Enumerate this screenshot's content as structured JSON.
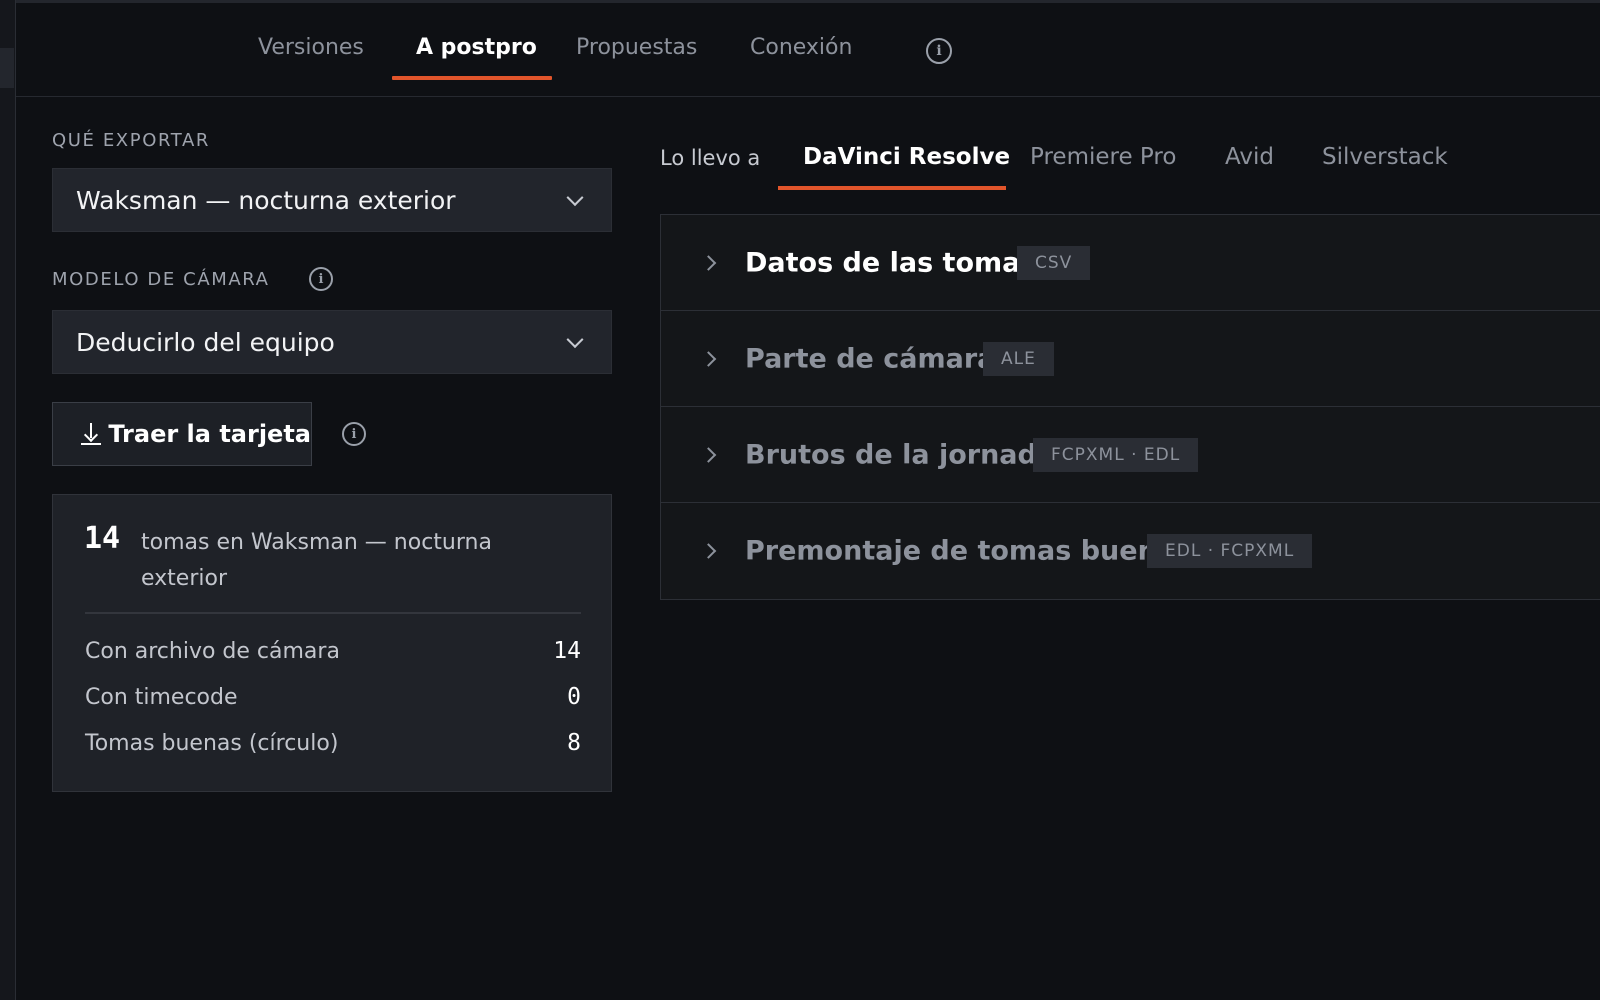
{
  "top_tabs": [
    {
      "label": "Versiones"
    },
    {
      "label": "A postpro",
      "active": true
    },
    {
      "label": "Propuestas"
    },
    {
      "label": "Conexión"
    }
  ],
  "export": {
    "section_label": "QUÉ EXPORTAR",
    "selected": "Waksman — nocturna exterior"
  },
  "camera": {
    "section_label": "MODELO DE CÁMARA",
    "selected": "Deducirlo del equipo"
  },
  "import_button": {
    "label": "Traer la tarjeta"
  },
  "summary": {
    "count": "14",
    "text": "tomas en Waksman — nocturna exterior",
    "stats": [
      {
        "label": "Con archivo de cámara",
        "value": "14"
      },
      {
        "label": "Con timecode",
        "value": "0"
      },
      {
        "label": "Tomas buenas (círculo)",
        "value": "8"
      }
    ]
  },
  "destination": {
    "label": "Lo llevo a",
    "tabs": [
      {
        "label": "DaVinci Resolve",
        "active": true
      },
      {
        "label": "Premiere Pro"
      },
      {
        "label": "Avid"
      },
      {
        "label": "Silverstack"
      }
    ]
  },
  "exports": [
    {
      "title": "Datos de las tomas",
      "format": "CSV",
      "active": true
    },
    {
      "title": "Parte de cámara",
      "format": "ALE"
    },
    {
      "title": "Brutos de la jornada",
      "format": "FCPXML · EDL"
    },
    {
      "title": "Premontaje de tomas buenas",
      "format": "EDL · FCPXML"
    }
  ],
  "colors": {
    "accent": "#e2552b",
    "background": "#0e1014",
    "panel": "#22252c"
  },
  "icons": [
    "info-icon",
    "chevron-down-icon",
    "download-icon",
    "chevron-right-icon"
  ]
}
